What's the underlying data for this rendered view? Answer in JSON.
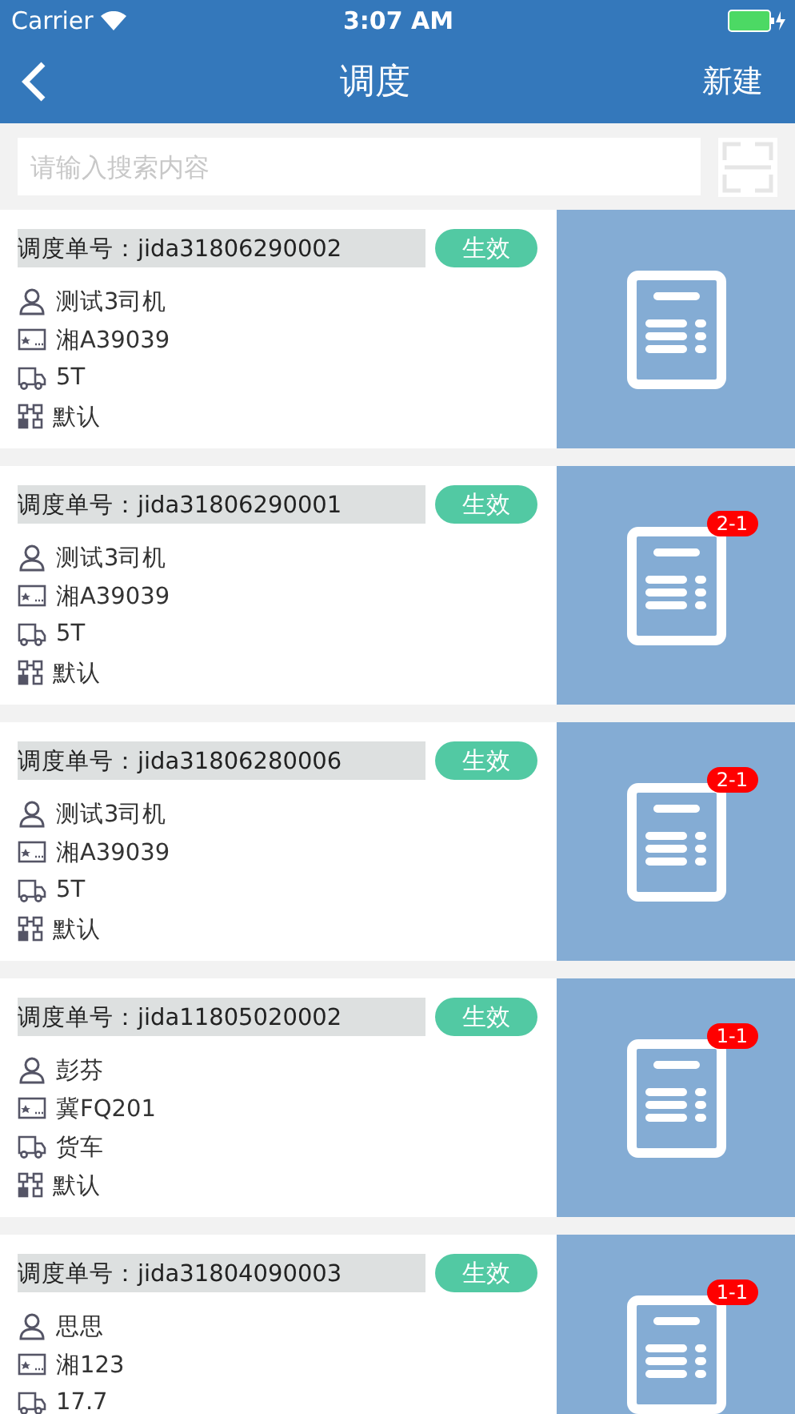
{
  "status_bar": {
    "carrier": "Carrier",
    "time": "3:07 AM"
  },
  "nav": {
    "title": "调度",
    "action": "新建"
  },
  "search": {
    "placeholder": "请输入搜索内容"
  },
  "orders": [
    {
      "label": "调度单号：",
      "number": "jida31806290002",
      "status": "生效",
      "driver": "测试3司机",
      "plate": "湘A39039",
      "vehicle": "5T",
      "route": "默认"
    },
    {
      "label": "调度单号：",
      "number": "jida31806290001",
      "status": "生效",
      "driver": "测试3司机",
      "plate": "湘A39039",
      "vehicle": "5T",
      "route": "默认",
      "badge": "2-1"
    },
    {
      "label": "调度单号：",
      "number": "jida31806280006",
      "status": "生效",
      "driver": "测试3司机",
      "plate": "湘A39039",
      "vehicle": "5T",
      "route": "默认",
      "badge": "2-1"
    },
    {
      "label": "调度单号：",
      "number": "jida11805020002",
      "status": "生效",
      "driver": "彭芬",
      "plate": "冀FQ201",
      "vehicle": "货车",
      "route": "默认",
      "badge": "1-1"
    },
    {
      "label": "调度单号：",
      "number": "jida31804090003",
      "status": "生效",
      "driver": "思思",
      "plate": "湘123",
      "vehicle": "17.7",
      "badge": "1-1"
    }
  ]
}
